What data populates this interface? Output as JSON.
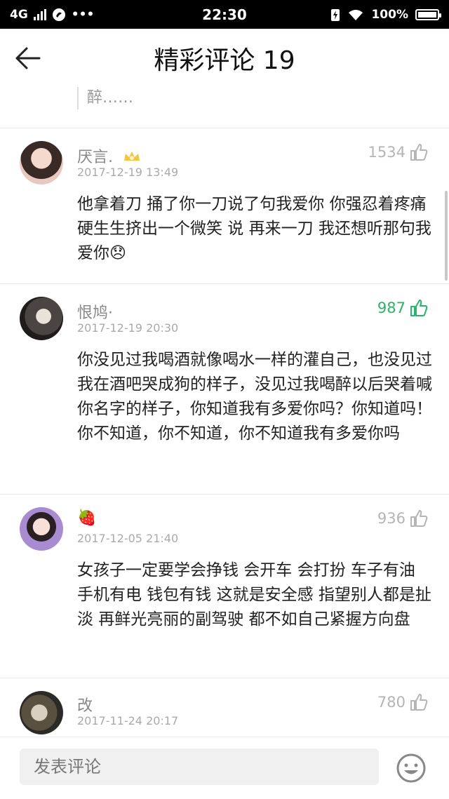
{
  "status_bar": {
    "network": "4G",
    "time": "22:30",
    "battery": "100%"
  },
  "header": {
    "title": "精彩评论 19"
  },
  "quote": {
    "text": "醉……"
  },
  "comments": [
    {
      "name": "厌言.",
      "date": "2017-12-19 13:49",
      "likes": "1534",
      "text": "他拿着刀 捅了你一刀说了句我爱你 你强忍着疼痛硬生生挤出一个微笑 说 再来一刀 我还想听那句我爱你😞",
      "liked": false
    },
    {
      "name": "恨鸠·",
      "date": "2017-12-19 20:30",
      "likes": "987",
      "text": "你没见过我喝酒就像喝水一样的灌自己，也没见过我在酒吧哭成狗的样子，没见过我喝醉以后哭着喊你名字的样子，你知道我有多爱你吗？你知道吗！你不知道，你不知道，你不知道我有多爱你吗",
      "liked": true
    },
    {
      "name": "🍓",
      "date": "2017-12-05 21:40",
      "likes": "936",
      "text": "女孩子一定要学会挣钱 会开车 会打扮 车子有油 手机有电 钱包有钱 这就是安全感 指望别人都是扯淡 再鲜光亮丽的副驾驶 都不如自己紧握方向盘",
      "liked": false
    },
    {
      "name": "改",
      "date": "2017-11-24 20:17",
      "likes": "780",
      "text": "",
      "liked": false
    }
  ],
  "bottom_bar": {
    "placeholder": "发表评论"
  },
  "colors": {
    "accent": "#2ab36b",
    "muted": "#b5b5b5"
  }
}
